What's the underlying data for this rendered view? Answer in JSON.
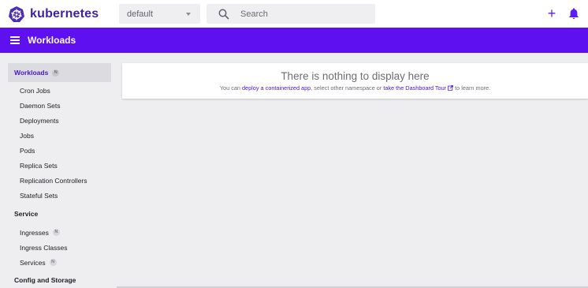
{
  "brand": {
    "name": "kubernetes",
    "icon": "kubernetes-logo"
  },
  "namespace": {
    "selected": "default"
  },
  "search": {
    "placeholder": "Search"
  },
  "actions": {
    "create_icon": "+",
    "notifications_icon": "bell-icon"
  },
  "appbar": {
    "title": "Workloads"
  },
  "sidebar": {
    "workloads": {
      "label": "Workloads",
      "badge": "N"
    },
    "workload_items": [
      "Cron Jobs",
      "Daemon Sets",
      "Deployments",
      "Jobs",
      "Pods",
      "Replica Sets",
      "Replication Controllers",
      "Stateful Sets"
    ],
    "service": {
      "label": "Service"
    },
    "service_items": [
      {
        "label": "Ingresses",
        "badge": "N"
      },
      {
        "label": "Ingress Classes"
      },
      {
        "label": "Services",
        "badge": "N"
      }
    ],
    "config_storage": {
      "label": "Config and Storage"
    }
  },
  "empty_state": {
    "title": "There is nothing to display here",
    "prefix": "You can ",
    "link1": "deploy a containerized app",
    "middle": ", select other namespace or ",
    "link2": "take the Dashboard Tour",
    "suffix": " to learn more."
  },
  "colors": {
    "accent": "#5e10f0",
    "link": "#4a13d6",
    "background": "#eeeef1"
  }
}
